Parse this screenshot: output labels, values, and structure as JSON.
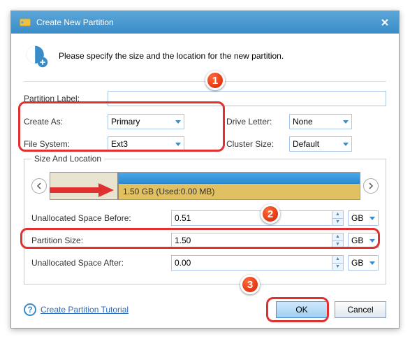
{
  "titlebar": {
    "title": "Create New Partition"
  },
  "header": {
    "instruction": "Please specify the size and the location for the new partition."
  },
  "form": {
    "partition_label_label": "Partition Label:",
    "partition_label_value": "",
    "create_as_label": "Create As:",
    "create_as_value": "Primary",
    "drive_letter_label": "Drive Letter:",
    "drive_letter_value": "None",
    "file_system_label": "File System:",
    "file_system_value": "Ext3",
    "cluster_size_label": "Cluster Size:",
    "cluster_size_value": "Default"
  },
  "size_location": {
    "title": "Size And Location",
    "visual_label": "1.50 GB (Used:0.00 MB)",
    "unalloc_before_label": "Unallocated Space Before:",
    "unalloc_before_value": "0.51",
    "partition_size_label": "Partition Size:",
    "partition_size_value": "1.50",
    "unalloc_after_label": "Unallocated Space After:",
    "unalloc_after_value": "0.00",
    "unit1": "GB",
    "unit2": "GB",
    "unit3": "GB"
  },
  "footer": {
    "tutorial_link": "Create Partition Tutorial",
    "ok": "OK",
    "cancel": "Cancel"
  },
  "annotations": {
    "badge1": "1",
    "badge2": "2",
    "badge3": "3"
  }
}
